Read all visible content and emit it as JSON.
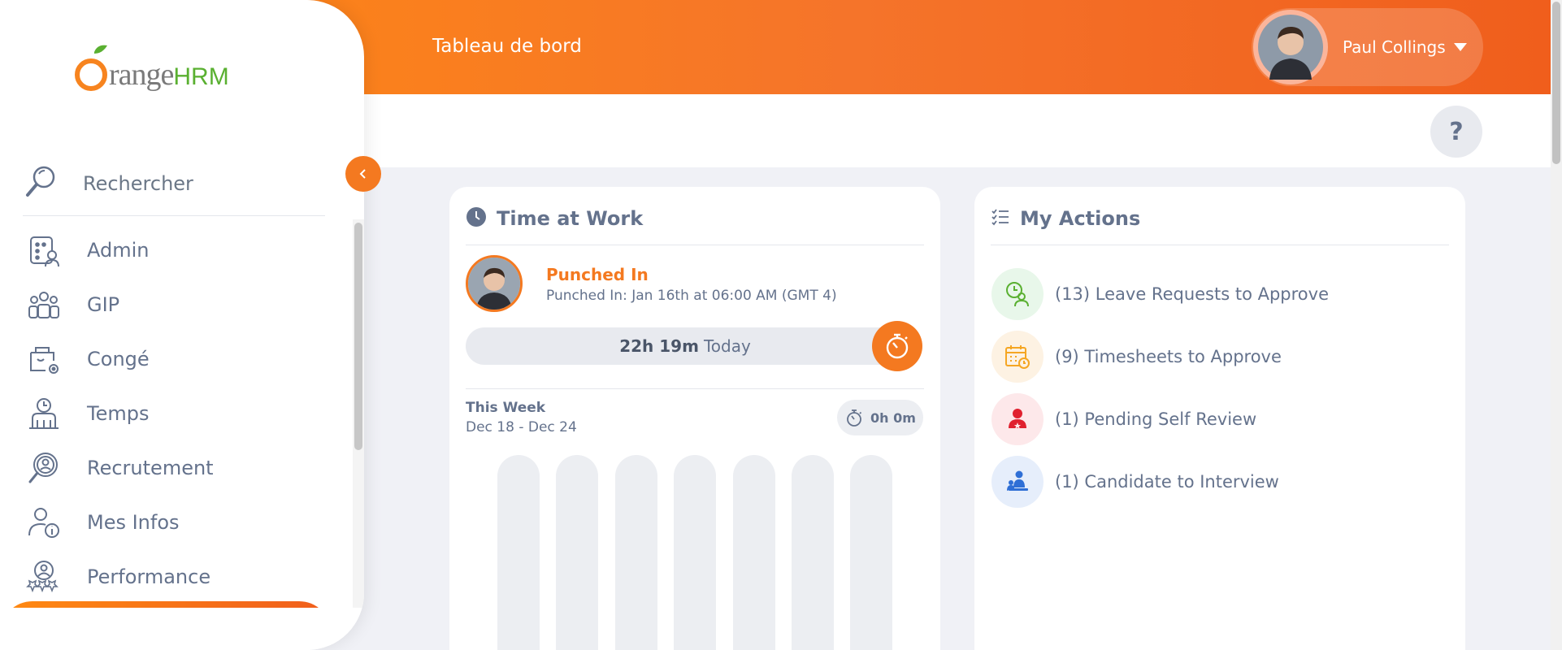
{
  "header": {
    "page_title": "Tableau de bord",
    "user_name": "Paul Collings"
  },
  "help": {
    "label": "?"
  },
  "sidebar": {
    "search_label": "Rechercher",
    "items": [
      {
        "label": "Admin",
        "icon": "admin-icon"
      },
      {
        "label": "GIP",
        "icon": "pim-icon"
      },
      {
        "label": "Congé",
        "icon": "leave-icon"
      },
      {
        "label": "Temps",
        "icon": "time-icon"
      },
      {
        "label": "Recrutement",
        "icon": "recruitment-icon"
      },
      {
        "label": "Mes Infos",
        "icon": "my-info-icon"
      },
      {
        "label": "Performance",
        "icon": "performance-icon"
      }
    ]
  },
  "time_at_work": {
    "title": "Time at Work",
    "status": "Punched In",
    "detail": "Punched In: Jan 16th at 06:00 AM (GMT 4)",
    "today_hours": "22h 19m",
    "today_label": "Today",
    "week_label": "This Week",
    "week_range": "Dec 18 - Dec 24",
    "week_total": "0h 0m"
  },
  "my_actions": {
    "title": "My Actions",
    "items": [
      {
        "label": "(13) Leave Requests to Approve",
        "icon": "leave-approve-icon",
        "bg": "#e8f7ea",
        "color": "#5ab031"
      },
      {
        "label": "(9) Timesheets to Approve",
        "icon": "timesheet-icon",
        "bg": "#fdf2e3",
        "color": "#f5a623"
      },
      {
        "label": "(1) Pending Self Review",
        "icon": "self-review-icon",
        "bg": "#fde8ea",
        "color": "#e0212f"
      },
      {
        "label": "(1) Candidate to Interview",
        "icon": "candidate-icon",
        "bg": "#e6eefb",
        "color": "#2f6fd6"
      }
    ]
  },
  "colors": {
    "brand_orange": "#f47920",
    "logo_green": "#5ab031"
  }
}
